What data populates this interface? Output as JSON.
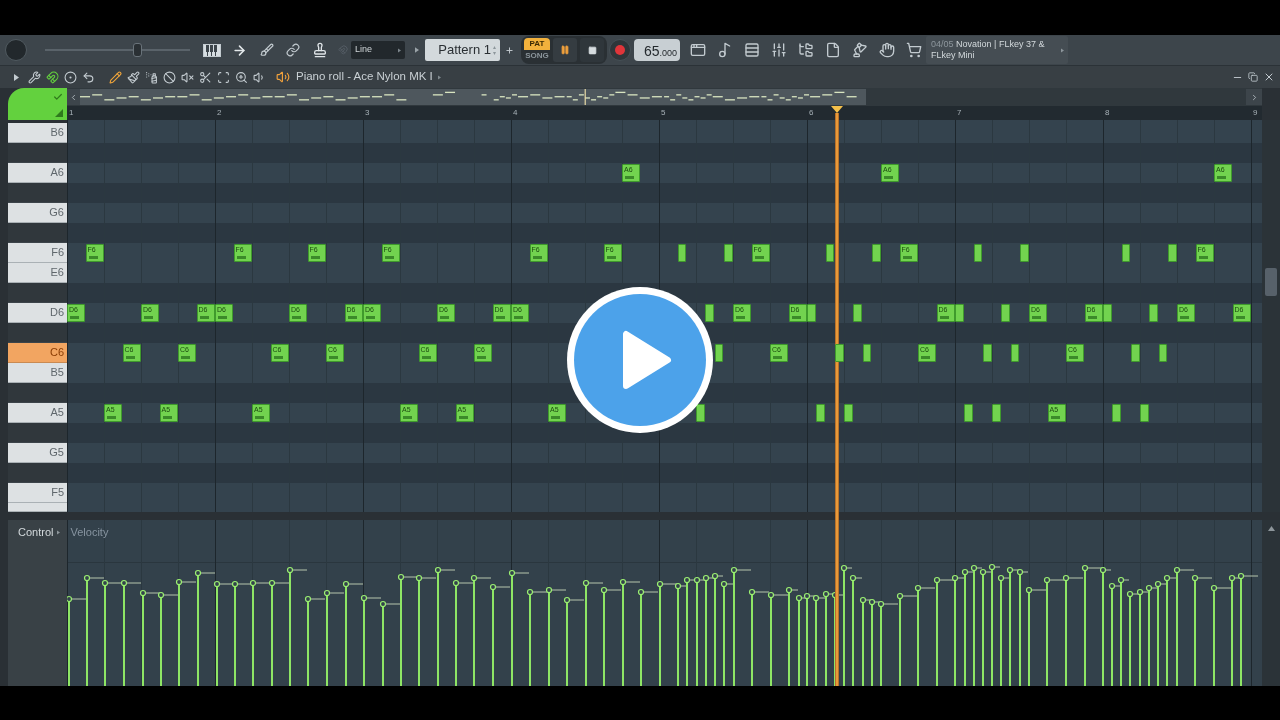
{
  "toolbar": {
    "master_slider": {
      "level": 0.64
    },
    "dropdown": "Line",
    "pattern": "Pattern 1",
    "mode": [
      {
        "label": "PAT",
        "selected": true
      },
      {
        "label": "SONG",
        "selected": false
      }
    ],
    "tempo": "65.000",
    "hint": {
      "counter": "04/05",
      "text": "Novation | FLkey 37 & FLkey Mini"
    }
  },
  "piano_roll": {
    "title": "Piano roll - Ace Nylon MK I",
    "magnet": {
      "on": true
    },
    "tools": [
      {
        "kind": "pencil",
        "selected": true
      },
      {
        "kind": "brush",
        "selected": false
      },
      {
        "kind": "spray",
        "selected": false
      },
      {
        "kind": "delete",
        "selected": false
      },
      {
        "kind": "mute",
        "selected": false
      },
      {
        "kind": "slice",
        "selected": false
      },
      {
        "kind": "select",
        "selected": false
      },
      {
        "kind": "zoom",
        "selected": false
      },
      {
        "kind": "playback",
        "selected": false
      }
    ],
    "ruler": [
      "1",
      "2",
      "3",
      "4",
      "5",
      "6",
      "7",
      "8",
      "9"
    ],
    "playhead": {
      "level": 0.642
    },
    "keys": [
      {
        "kind": "white",
        "label": "B6",
        "selected": false
      },
      {
        "kind": "black",
        "selected": false
      },
      {
        "kind": "white",
        "label": "A6",
        "selected": false,
        "notes": [
          {
            "kind": "long",
            "label": "A6"
          },
          {
            "kind": "long",
            "label": "A6"
          },
          {
            "kind": "long",
            "label": "A6"
          }
        ]
      },
      {
        "kind": "black",
        "selected": false
      },
      {
        "kind": "white",
        "label": "G6",
        "selected": false
      },
      {
        "kind": "black",
        "selected": false
      },
      {
        "kind": "white",
        "label": "F6",
        "selected": false,
        "notes": [
          {
            "kind": "long",
            "label": "F6"
          },
          {
            "kind": "long",
            "label": "F6"
          },
          {
            "kind": "long",
            "label": "F6"
          },
          {
            "kind": "long",
            "label": "F6"
          },
          {
            "kind": "long",
            "label": "F6"
          },
          {
            "kind": "long",
            "label": "F6"
          },
          {
            "kind": "short"
          },
          {
            "kind": "short"
          },
          {
            "kind": "long",
            "label": "F6"
          },
          {
            "kind": "short"
          },
          {
            "kind": "short"
          },
          {
            "kind": "long",
            "label": "F6"
          },
          {
            "kind": "short"
          },
          {
            "kind": "short"
          },
          {
            "kind": "short"
          },
          {
            "kind": "short"
          },
          {
            "kind": "long",
            "label": "F6"
          }
        ]
      },
      {
        "kind": "white",
        "label": "E6",
        "selected": false
      },
      {
        "kind": "black",
        "selected": false
      },
      {
        "kind": "white",
        "label": "D6",
        "selected": false,
        "notes": [
          {
            "kind": "long",
            "label": "D6"
          },
          {
            "kind": "long",
            "label": "D6"
          },
          {
            "kind": "long",
            "label": "D6"
          },
          {
            "kind": "long",
            "label": "D6"
          },
          {
            "kind": "long",
            "label": "D6"
          },
          {
            "kind": "long",
            "label": "D6"
          },
          {
            "kind": "long",
            "label": "D6"
          },
          {
            "kind": "long",
            "label": "D6"
          },
          {
            "kind": "long",
            "label": "D6"
          },
          {
            "kind": "long",
            "label": "D6"
          },
          {
            "kind": "short"
          },
          {
            "kind": "long",
            "label": "D6"
          },
          {
            "kind": "long",
            "label": "D6"
          },
          {
            "kind": "short"
          },
          {
            "kind": "short"
          },
          {
            "kind": "long",
            "label": "D6"
          },
          {
            "kind": "short"
          },
          {
            "kind": "short"
          },
          {
            "kind": "long",
            "label": "D6"
          },
          {
            "kind": "long",
            "label": "D6"
          },
          {
            "kind": "short"
          },
          {
            "kind": "short"
          },
          {
            "kind": "long",
            "label": "D6"
          },
          {
            "kind": "long",
            "label": "D6"
          }
        ]
      },
      {
        "kind": "black",
        "selected": false
      },
      {
        "kind": "white",
        "label": "C6",
        "selected": true,
        "notes": [
          {
            "kind": "long",
            "label": "C6"
          },
          {
            "kind": "long",
            "label": "C6"
          },
          {
            "kind": "long",
            "label": "C6"
          },
          {
            "kind": "long",
            "label": "C6"
          },
          {
            "kind": "long",
            "label": "C6"
          },
          {
            "kind": "long",
            "label": "C6"
          },
          {
            "kind": "short"
          },
          {
            "kind": "long",
            "label": "C6"
          },
          {
            "kind": "short"
          },
          {
            "kind": "short"
          },
          {
            "kind": "long",
            "label": "C6"
          },
          {
            "kind": "short"
          },
          {
            "kind": "short"
          },
          {
            "kind": "long",
            "label": "C6"
          },
          {
            "kind": "short"
          },
          {
            "kind": "short"
          }
        ]
      },
      {
        "kind": "white",
        "label": "B5",
        "selected": false
      },
      {
        "kind": "black",
        "selected": false
      },
      {
        "kind": "white",
        "label": "A5",
        "selected": false,
        "notes": [
          {
            "kind": "long",
            "label": "A5"
          },
          {
            "kind": "long",
            "label": "A5"
          },
          {
            "kind": "long",
            "label": "A5"
          },
          {
            "kind": "long",
            "label": "A5"
          },
          {
            "kind": "long",
            "label": "A5"
          },
          {
            "kind": "long",
            "label": "A5"
          },
          {
            "kind": "short"
          },
          {
            "kind": "short"
          },
          {
            "kind": "short"
          },
          {
            "kind": "short"
          },
          {
            "kind": "short"
          },
          {
            "kind": "long",
            "label": "A5"
          },
          {
            "kind": "short"
          },
          {
            "kind": "short"
          }
        ]
      },
      {
        "kind": "black",
        "selected": false
      },
      {
        "kind": "white",
        "label": "G5",
        "selected": false
      },
      {
        "kind": "black",
        "selected": false
      },
      {
        "kind": "white",
        "label": "F5",
        "selected": false
      },
      {
        "kind": "white",
        "selected": false
      }
    ],
    "control": {
      "label": "Control",
      "parameter": "Velocity"
    }
  }
}
